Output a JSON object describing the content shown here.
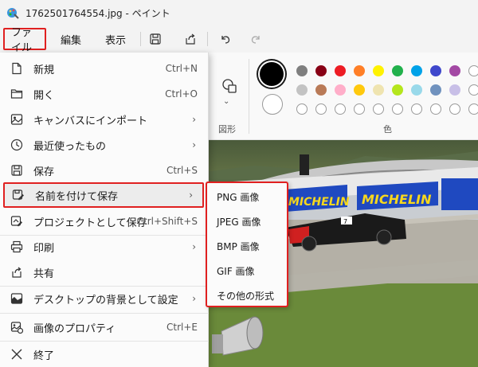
{
  "window": {
    "title": "1762501764554.jpg - ペイント"
  },
  "menubar": {
    "file": "ファイル",
    "edit": "編集",
    "view": "表示"
  },
  "ribbon": {
    "shapes_label": "図形",
    "colors_label": "色",
    "primary_color": "#000000",
    "secondary_color": "#ffffff",
    "palette_row1": [
      "#7f7f7f",
      "#880015",
      "#ed1c24",
      "#ff7f27",
      "#fff200",
      "#22b14c",
      "#00a2e8",
      "#3f48cc",
      "#a349a4"
    ],
    "palette_row2": [
      "#c3c3c3",
      "#b97a57",
      "#ffaec9",
      "#ffc90e",
      "#efe4b0",
      "#b5e61d",
      "#99d9ea",
      "#7092be",
      "#c8bfe7"
    ]
  },
  "file_menu": {
    "items": [
      {
        "label": "新規",
        "shortcut": "Ctrl+N",
        "icon": "new-file-icon"
      },
      {
        "label": "開く",
        "shortcut": "Ctrl+O",
        "icon": "folder-icon"
      },
      {
        "label": "キャンバスにインポート",
        "shortcut": "",
        "icon": "import-icon",
        "submenu": true
      },
      {
        "label": "最近使ったもの",
        "shortcut": "",
        "icon": "clock-icon",
        "submenu": true
      },
      {
        "label": "保存",
        "shortcut": "Ctrl+S",
        "icon": "save-icon"
      },
      {
        "label": "名前を付けて保存",
        "shortcut": "",
        "icon": "save-as-icon",
        "submenu": true
      },
      {
        "label": "プロジェクトとして保存",
        "shortcut": "Ctrl+Shift+S",
        "icon": "project-icon"
      },
      {
        "label": "印刷",
        "shortcut": "",
        "icon": "printer-icon",
        "submenu": true
      },
      {
        "label": "共有",
        "shortcut": "",
        "icon": "share-icon"
      },
      {
        "label": "デスクトップの背景として設定",
        "shortcut": "",
        "icon": "desktop-icon",
        "submenu": true
      },
      {
        "label": "画像のプロパティ",
        "shortcut": "Ctrl+E",
        "icon": "properties-icon"
      },
      {
        "label": "終了",
        "shortcut": "",
        "icon": "close-icon"
      }
    ]
  },
  "save_as_submenu": {
    "items": [
      "PNG 画像",
      "JPEG 画像",
      "BMP 画像",
      "GIF 画像",
      "その他の形式"
    ]
  },
  "canvas": {
    "banner_text": "MICHELIN",
    "car_number": "7"
  }
}
